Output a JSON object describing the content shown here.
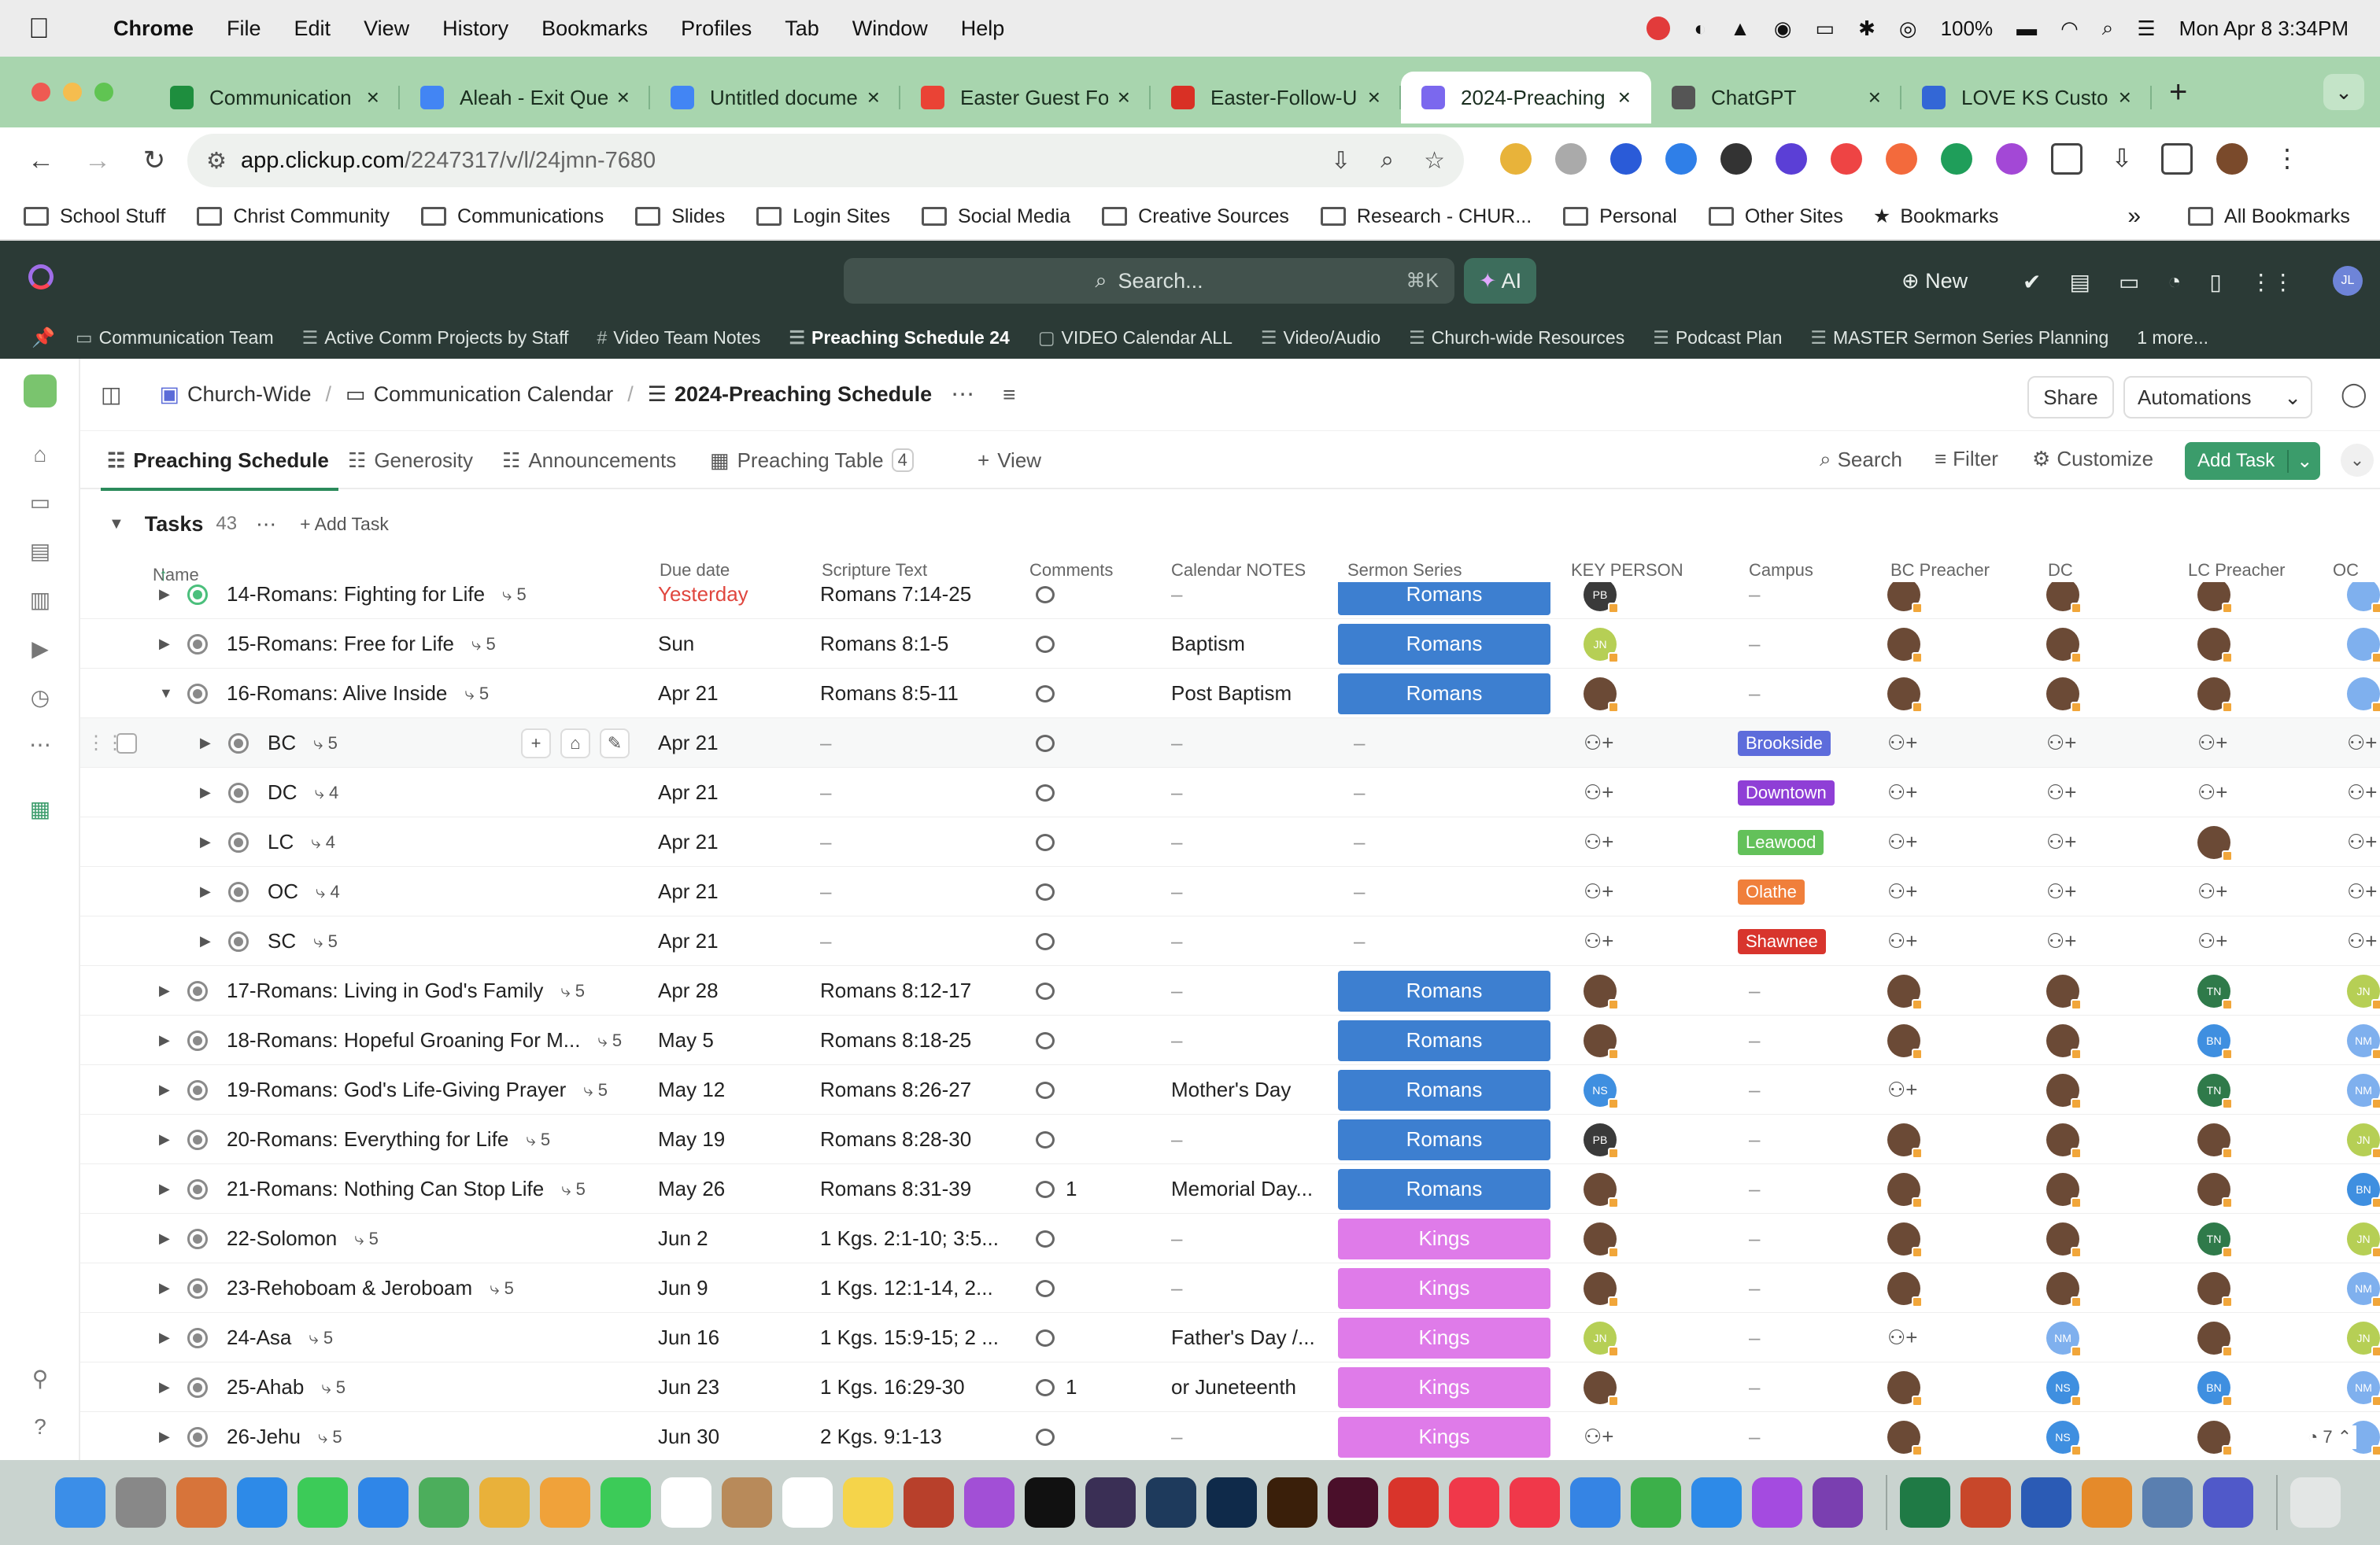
{
  "mac_menu": {
    "app": "Chrome",
    "items": [
      "File",
      "Edit",
      "View",
      "History",
      "Bookmarks",
      "Profiles",
      "Tab",
      "Window",
      "Help"
    ],
    "battery": "100%",
    "datetime": "Mon Apr 8  3:34PM"
  },
  "browser_tabs": [
    {
      "title": "Communication",
      "icon_color": "#1e8e3e"
    },
    {
      "title": "Aleah - Exit Que",
      "icon_color": "#4285f4"
    },
    {
      "title": "Untitled docume",
      "icon_color": "#4285f4"
    },
    {
      "title": "Easter Guest Fo",
      "icon_color": "#ea4335"
    },
    {
      "title": "Easter-Follow-U",
      "icon_color": "#d93025"
    },
    {
      "title": "2024-Preaching",
      "icon_color": "#7b68ee",
      "active": true
    },
    {
      "title": "ChatGPT",
      "icon_color": "#555555"
    },
    {
      "title": "LOVE KS Custon",
      "icon_color": "#3367d6"
    }
  ],
  "address": {
    "host": "app.clickup.com",
    "path": "/2247317/v/l/24jmn-7680"
  },
  "bookmarks": [
    "School Stuff",
    "Christ Community",
    "Communications",
    "Slides",
    "Login Sites",
    "Social Media",
    "Creative Sources",
    "Research - CHUR...",
    "Personal",
    "Other Sites"
  ],
  "bookmarks_star": "Bookmarks",
  "bookmarks_more": "»",
  "all_bookmarks": "All Bookmarks",
  "clickup": {
    "search_placeholder": "Search...",
    "search_shortcut": "⌘K",
    "ai_label": "AI",
    "new_label": "New",
    "avatar_initials": "JL",
    "favorites": [
      {
        "icon": "▭",
        "label": "Communication Team"
      },
      {
        "icon": "☰",
        "label": "Active Comm Projects by Staff"
      },
      {
        "icon": "#",
        "label": "Video Team Notes"
      },
      {
        "icon": "☰",
        "label": "Preaching Schedule 24",
        "current": true
      },
      {
        "icon": "▢",
        "label": "VIDEO Calendar ALL"
      },
      {
        "icon": "☰",
        "label": "Video/Audio"
      },
      {
        "icon": "☰",
        "label": "Church-wide Resources"
      },
      {
        "icon": "☰",
        "label": "Podcast Plan"
      },
      {
        "icon": "☰",
        "label": "MASTER Sermon Series Planning"
      },
      {
        "icon": "",
        "label": "1 more..."
      }
    ]
  },
  "breadcrumb": {
    "space": "Church-Wide",
    "folder": "Communication Calendar",
    "list": "2024-Preaching Schedule"
  },
  "header_buttons": {
    "share": "Share",
    "automations": "Automations"
  },
  "views": [
    {
      "label": "Preaching Schedule",
      "active": true
    },
    {
      "label": "Generosity"
    },
    {
      "label": "Announcements"
    },
    {
      "label": "Preaching Table",
      "count": "4"
    }
  ],
  "add_view": "View",
  "toolbar": {
    "search": "Search",
    "filter": "Filter",
    "customize": "Customize",
    "add_task": "Add Task"
  },
  "group": {
    "name": "Tasks",
    "count": "43",
    "add_task": "Add Task"
  },
  "columns": [
    "Name",
    "Due date",
    "Scripture Text",
    "Comments",
    "Calendar NOTES",
    "Sermon Series",
    "KEY PERSON",
    "Campus",
    "BC Preacher",
    "DC",
    "LC Preacher",
    "OC"
  ],
  "colors": {
    "romans": "#3d7fd0",
    "kings": "#df7be9",
    "brookside": "#5d6cdb",
    "downtown": "#8f3fd6",
    "leawood": "#63c15a",
    "olathe": "#f07f3b",
    "shawnee": "#d8352d",
    "overdue": "#e0463e"
  },
  "rows": [
    {
      "kind": "task",
      "name": "14-Romans: Fighting for Life",
      "subs": "5",
      "due": "Yesterday",
      "overdue": true,
      "scripture": "Romans 7:14-25",
      "comments": "",
      "notes": "–",
      "series": "Romans",
      "key": "PB",
      "campus": "–",
      "green_status": true
    },
    {
      "kind": "task",
      "name": "15-Romans: Free for Life",
      "subs": "5",
      "due": "Sun",
      "scripture": "Romans 8:1-5",
      "comments": "",
      "notes": "Baptism",
      "series": "Romans",
      "key": "JN",
      "campus": "–"
    },
    {
      "kind": "task",
      "name": "16-Romans: Alive Inside",
      "subs": "5",
      "due": "Apr 21",
      "scripture": "Romans 8:5-11",
      "comments": "",
      "notes": "Post Baptism",
      "series": "Romans",
      "key": "img",
      "campus": "–",
      "expanded": true
    },
    {
      "kind": "sub",
      "name": "BC",
      "subs": "5",
      "due": "Apr 21",
      "scripture": "–",
      "notes": "–",
      "series": "–",
      "campus": "Brookside",
      "hover": true
    },
    {
      "kind": "sub",
      "name": "DC",
      "subs": "4",
      "due": "Apr 21",
      "scripture": "–",
      "notes": "–",
      "series": "–",
      "campus": "Downtown"
    },
    {
      "kind": "sub",
      "name": "LC",
      "subs": "4",
      "due": "Apr 21",
      "scripture": "–",
      "notes": "–",
      "series": "–",
      "campus": "Leawood",
      "lc_filled": true
    },
    {
      "kind": "sub",
      "name": "OC",
      "subs": "4",
      "due": "Apr 21",
      "scripture": "–",
      "notes": "–",
      "series": "–",
      "campus": "Olathe"
    },
    {
      "kind": "sub",
      "name": "SC",
      "subs": "5",
      "due": "Apr 21",
      "scripture": "–",
      "notes": "–",
      "series": "–",
      "campus": "Shawnee"
    },
    {
      "kind": "task",
      "name": "17-Romans: Living in God's Family",
      "subs": "5",
      "due": "Apr 28",
      "scripture": "Romans 8:12-17",
      "comments": "",
      "notes": "–",
      "series": "Romans",
      "key": "img",
      "campus": "–",
      "lc": "TN",
      "oc": "JN"
    },
    {
      "kind": "task",
      "name": "18-Romans: Hopeful Groaning For M...",
      "subs": "5",
      "due": "May 5",
      "scripture": "Romans 8:18-25",
      "comments": "",
      "notes": "–",
      "series": "Romans",
      "key": "img",
      "campus": "–",
      "lc": "BN",
      "oc": "NM"
    },
    {
      "kind": "task",
      "name": "19-Romans: God's Life-Giving Prayer",
      "subs": "5",
      "due": "May 12",
      "scripture": "Romans 8:26-27",
      "comments": "",
      "notes": "Mother's Day",
      "series": "Romans",
      "key": "NS",
      "campus": "–",
      "bc_add": true,
      "lc": "TN",
      "oc": "NM"
    },
    {
      "kind": "task",
      "name": "20-Romans: Everything for Life",
      "subs": "5",
      "due": "May 19",
      "scripture": "Romans 8:28-30",
      "comments": "",
      "notes": "–",
      "series": "Romans",
      "key": "PB",
      "campus": "–",
      "oc": "JN"
    },
    {
      "kind": "task",
      "name": "21-Romans: Nothing Can Stop Life",
      "subs": "5",
      "due": "May 26",
      "scripture": "Romans 8:31-39",
      "comments": "1",
      "notes": "Memorial Day...",
      "series": "Romans",
      "key": "img",
      "campus": "–",
      "oc": "BN"
    },
    {
      "kind": "task",
      "name": "22-Solomon",
      "subs": "5",
      "due": "Jun 2",
      "scripture": "1 Kgs. 2:1-10; 3:5...",
      "comments": "",
      "notes": "–",
      "series": "Kings",
      "key": "img",
      "campus": "–",
      "lc": "TN",
      "oc": "JN"
    },
    {
      "kind": "task",
      "name": "23-Rehoboam & Jeroboam",
      "subs": "5",
      "due": "Jun 9",
      "scripture": "1 Kgs. 12:1-14, 2...",
      "comments": "",
      "notes": "–",
      "series": "Kings",
      "key": "img",
      "campus": "–",
      "oc": "NM"
    },
    {
      "kind": "task",
      "name": "24-Asa",
      "subs": "5",
      "due": "Jun 16",
      "scripture": "1 Kgs. 15:9-15; 2 ...",
      "comments": "",
      "notes": "Father's Day /...",
      "series": "Kings",
      "key": "JN",
      "campus": "–",
      "bc_add": true,
      "dc": "NM",
      "oc": "JN"
    },
    {
      "kind": "task",
      "name": "25-Ahab",
      "subs": "5",
      "due": "Jun 23",
      "scripture": "1 Kgs. 16:29-30",
      "comments": "1",
      "notes": "or Juneteenth",
      "series": "Kings",
      "key": "img",
      "campus": "–",
      "dc": "NS",
      "lc": "BN",
      "oc": "NM"
    },
    {
      "kind": "task",
      "name": "26-Jehu",
      "subs": "5",
      "due": "Jun 30",
      "scripture": "2 Kgs. 9:1-13",
      "comments": "",
      "notes": "–",
      "series": "Kings",
      "key": "add",
      "campus": "–",
      "dc": "NS"
    }
  ],
  "footer_count": "7"
}
